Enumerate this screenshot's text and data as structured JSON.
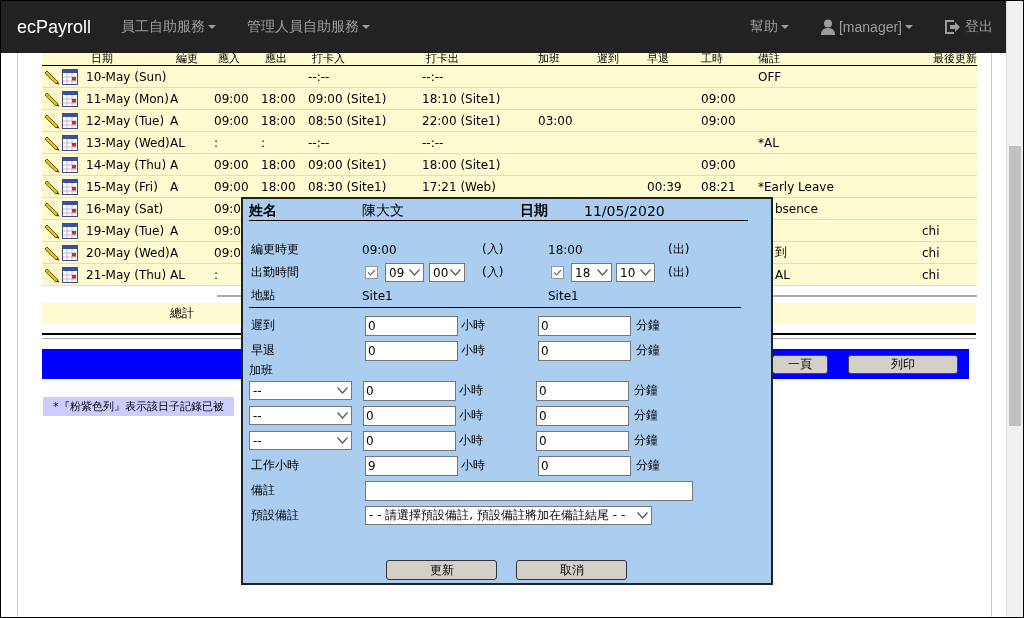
{
  "navbar": {
    "brand": "ecPayroll",
    "menus": [
      {
        "label": "員工自助服務",
        "kind": "dropdown"
      },
      {
        "label": "管理人員自助服務",
        "kind": "dropdown"
      }
    ],
    "right_menus": [
      {
        "label": "幫助",
        "kind": "dropdown"
      },
      {
        "label": "[manager]",
        "kind": "user"
      },
      {
        "label": "登出",
        "kind": "logout"
      }
    ]
  },
  "table": {
    "columns": [
      "日期",
      "編更",
      "應入",
      "應出",
      "打卡入",
      "打卡出",
      "加班",
      "遲到",
      "早退",
      "工時",
      "備註",
      "最後更新"
    ],
    "rows": [
      {
        "date": "10-May (Sun)",
        "punch_in": "--:--",
        "punch_out": "--:--",
        "remark": "OFF"
      },
      {
        "date": "11-May (Mon)",
        "shift": "A",
        "in": "09:00",
        "out": "18:00",
        "punch_in": "09:00 (Site1)",
        "punch_out": "18:10 (Site1)",
        "hours": "09:00"
      },
      {
        "date": "12-May (Tue)",
        "shift": "A",
        "in": "09:00",
        "out": "18:00",
        "punch_in": "08:50 (Site1)",
        "punch_out": "22:00 (Site1)",
        "overtime": "03:00",
        "hours": "09:00"
      },
      {
        "date": "13-May (Wed)",
        "shift": "AL",
        "in": ":",
        "out": ":",
        "punch_in": "--:--",
        "punch_out": "--:--",
        "remark": "*AL"
      },
      {
        "date": "14-May (Thu)",
        "shift": "A",
        "in": "09:00",
        "out": "18:00",
        "punch_in": "09:00 (Site1)",
        "punch_out": "18:00 (Site1)",
        "hours": "09:00"
      },
      {
        "date": "15-May (Fri)",
        "shift": "A",
        "in": "09:00",
        "out": "18:00",
        "punch_in": "08:30 (Site1)",
        "punch_out": "17:21 (Web)",
        "early": "00:39",
        "hours": "08:21",
        "remark": "*Early Leave"
      },
      {
        "date": "16-May (Sat)",
        "in": "09:0",
        "remark": "bsence"
      },
      {
        "date": "19-May (Tue)",
        "shift": "A",
        "in": "09:0",
        "updated": "chi"
      },
      {
        "date": "20-May (Wed)",
        "shift": "A",
        "in": "09:0",
        "remark": "到",
        "updated": "chi"
      },
      {
        "date": "21-May (Thu)",
        "shift": "AL",
        "in": ":",
        "remark": "AL",
        "updated": "chi"
      }
    ],
    "total_label": "總計"
  },
  "bottom_bar": {
    "buttons": [
      "一頁",
      "列印"
    ]
  },
  "footnote": "*『粉紫色列』表示該日子記錄已被",
  "dialog": {
    "name_label": "姓名",
    "name": "陳大文",
    "date_label": "日期",
    "date": "11/05/2020",
    "shift_time": {
      "label": "編更時更",
      "in": "09:00",
      "in_tag": "(入)",
      "out": "18:00",
      "out_tag": "(出)"
    },
    "attendance": {
      "label": "出勤時間",
      "in_checked": true,
      "in_hour": "09",
      "in_minute": "00",
      "in_tag": "(入)",
      "out_checked": true,
      "out_hour": "18",
      "out_minute": "10",
      "out_tag": "(出)"
    },
    "location": {
      "label": "地點",
      "in": "Site1",
      "out": "Site1"
    },
    "late": {
      "label": "遲到",
      "hours": "0",
      "hours_unit": "小時",
      "minutes": "0",
      "minutes_unit": "分鐘"
    },
    "early": {
      "label": "早退",
      "hours": "0",
      "hours_unit": "小時",
      "minutes": "0",
      "minutes_unit": "分鐘"
    },
    "overtime": {
      "label": "加班",
      "rows": [
        {
          "type": "--",
          "hours": "0",
          "hours_unit": "小時",
          "minutes": "0",
          "minutes_unit": "分鐘"
        },
        {
          "type": "--",
          "hours": "0",
          "hours_unit": "小時",
          "minutes": "0",
          "minutes_unit": "分鐘"
        },
        {
          "type": "--",
          "hours": "0",
          "hours_unit": "小時",
          "minutes": "0",
          "minutes_unit": "分鐘"
        }
      ]
    },
    "work_hours": {
      "label": "工作小時",
      "hours": "9",
      "hours_unit": "小時",
      "minutes": "0",
      "minutes_unit": "分鐘"
    },
    "remark": {
      "label": "備註"
    },
    "preset_remark": {
      "label": "預設備註",
      "value": "- - 請選擇預設備註, 預設備註將加在備註結尾 - -"
    },
    "buttons": [
      "更新",
      "取消"
    ]
  }
}
